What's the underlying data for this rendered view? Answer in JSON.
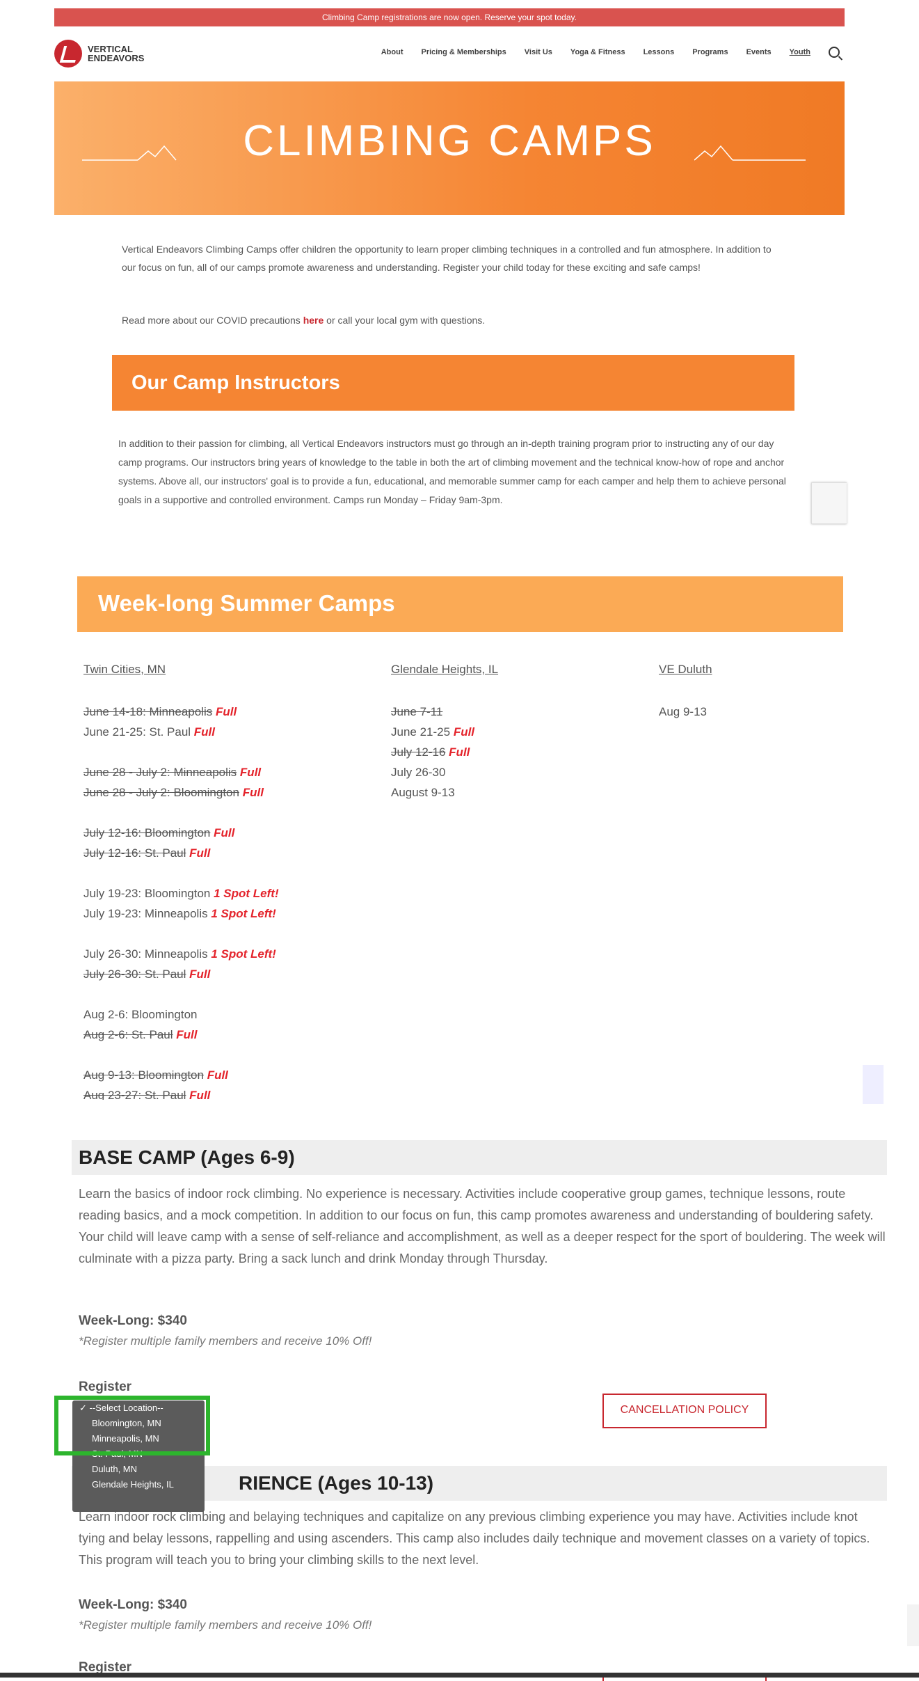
{
  "announcement": "Climbing Camp registrations are now open. Reserve your spot today.",
  "logo": {
    "line1": "VERTICAL",
    "line2": "ENDEAVORS"
  },
  "nav": {
    "items": [
      "About",
      "Pricing & Memberships",
      "Visit Us",
      "Yoga & Fitness",
      "Lessons",
      "Programs",
      "Events",
      "Youth"
    ],
    "active": "Youth"
  },
  "hero": {
    "title": "CLIMBING CAMPS"
  },
  "intro": {
    "p1": "Vertical Endeavors Climbing Camps offer children the opportunity to learn proper climbing techniques in a controlled and fun atmosphere. In addition to our focus on fun, all of our camps promote awareness and understanding. Register your child today for these exciting and safe camps!",
    "p2_before": "Read more about our COVID precautions ",
    "p2_link": "here",
    "p2_after": " or call your local gym with questions."
  },
  "instructors": {
    "title": "Our Camp Instructors",
    "text": "In addition to their passion for climbing, all Vertical Endeavors instructors must go through an in-depth training program prior to instructing any of our day camp programs. Our instructors bring years of knowledge to the table in both the art of climbing movement and the technical know-how of rope and anchor systems. Above all, our instructors' goal is to provide a fun, educational, and memorable summer camp for each camper and help them to achieve personal goals in a supportive and controlled environment. Camps run Monday – Friday 9am-3pm."
  },
  "summer": {
    "title": "Week-long Summer Camps",
    "col1": {
      "head": "Twin Cities, MN",
      "lines": [
        {
          "text": "June 14-18: Minneapolis",
          "strike": true,
          "tag": "Full"
        },
        {
          "text": "June 21-25: St. Paul",
          "strike": false,
          "tag": "Full"
        },
        {
          "text": "",
          "gap": true
        },
        {
          "text": "June 28 - July 2: Minneapolis",
          "strike": true,
          "tag": "Full"
        },
        {
          "text": "June 28 - July 2: Bloomington",
          "strike": true,
          "tag": "Full"
        },
        {
          "text": "",
          "gap": true
        },
        {
          "text": "July 12-16: Bloomington",
          "strike": true,
          "tag": "Full"
        },
        {
          "text": "July 12-16: St. Paul",
          "strike": true,
          "tag": "Full"
        },
        {
          "text": "",
          "gap": true
        },
        {
          "text": "July 19-23: Bloomington",
          "strike": false,
          "tag": "1 Spot Left!"
        },
        {
          "text": "July 19-23: Minneapolis",
          "strike": false,
          "tag": "1 Spot Left!"
        },
        {
          "text": "",
          "gap": true
        },
        {
          "text": "July 26-30: Minneapolis",
          "strike": false,
          "tag": "1 Spot Left!"
        },
        {
          "text": "July 26-30: St. Paul",
          "strike": true,
          "tag": "Full"
        },
        {
          "text": "",
          "gap": true
        },
        {
          "text": "Aug 2-6: Bloomington",
          "strike": false,
          "tag": ""
        },
        {
          "text": "Aug 2-6: St. Paul",
          "strike": true,
          "tag": "Full"
        },
        {
          "text": "",
          "gap": true
        },
        {
          "text": "Aug 9-13: Bloomington",
          "strike": true,
          "tag": "Full"
        },
        {
          "text": "Aug 23-27: St. Paul",
          "strike": true,
          "tag": "Full"
        }
      ]
    },
    "col2": {
      "head": "Glendale Heights, IL",
      "lines": [
        {
          "text": "June 7-11",
          "strike": true,
          "tag": ""
        },
        {
          "text": "June 21-25",
          "strike": false,
          "tag": "Full"
        },
        {
          "text": "July 12-16",
          "strike": true,
          "tag": "Full"
        },
        {
          "text": "July 26-30",
          "strike": false,
          "tag": ""
        },
        {
          "text": "August 9-13",
          "strike": false,
          "tag": ""
        }
      ]
    },
    "col3": {
      "head": "VE Duluth",
      "lines": [
        {
          "text": "Aug 9-13",
          "strike": false,
          "tag": ""
        }
      ]
    }
  },
  "base_camp": {
    "title": "BASE CAMP (Ages 6-9)",
    "text": "Learn the basics of indoor rock climbing. No experience is necessary. Activities include cooperative group games, technique lessons, route reading basics, and a mock competition. In addition to our focus on fun, this camp promotes awareness and understanding of bouldering safety. Your child will leave camp with a sense of self-reliance and accomplishment, as well as a deeper respect for the sport of bouldering. The week will culminate with a pizza party. Bring a sack lunch and drink Monday through Thursday.",
    "price": "Week-Long: $340",
    "note": "*Register multiple family members and receive 10% Off!",
    "register": "Register",
    "cancel": "CANCELLATION POLICY"
  },
  "dropdown": {
    "options": [
      "--Select Location--",
      "Bloomington, MN",
      "Minneapolis, MN",
      "St. Paul, MN",
      "Duluth, MN",
      "Glendale Heights, IL"
    ],
    "selected": "--Select Location--"
  },
  "experience_camp": {
    "title_visible": "RIENCE (Ages 10-13)",
    "text": "Learn indoor rock climbing and belaying techniques and capitalize on any previous climbing experience you may have. Activities include knot tying and belay lessons, rappelling and using ascenders. This camp also includes daily technique and movement classes on a variety of topics. This program will teach you to bring your climbing skills to the next level.",
    "price": "Week-Long: $340",
    "note": "*Register multiple family members and receive 10% Off!",
    "register": "Register"
  }
}
